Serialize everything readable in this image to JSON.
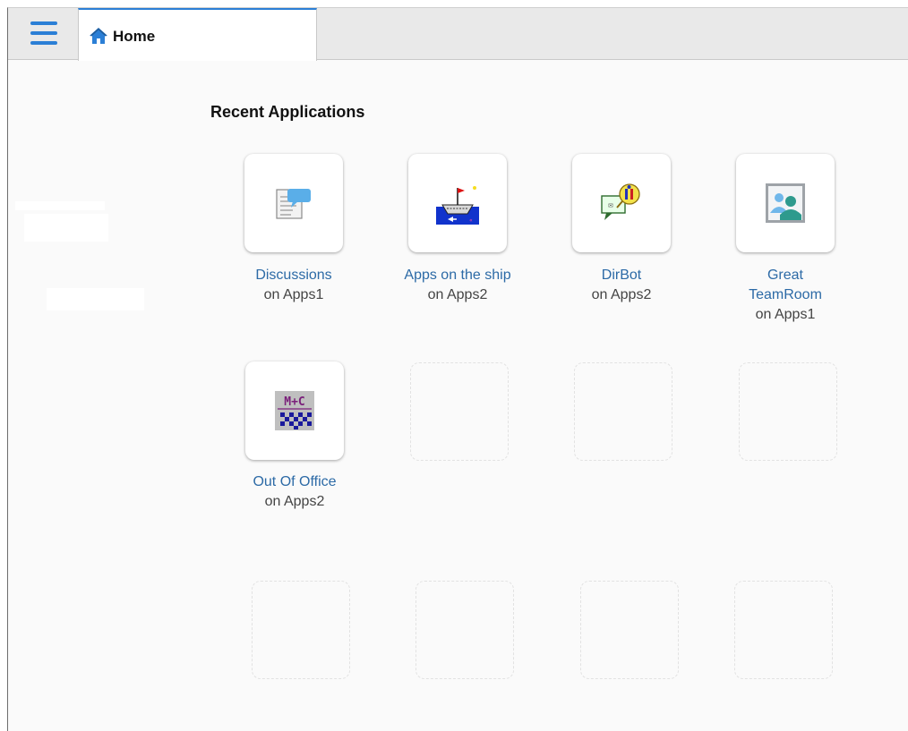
{
  "header": {
    "menu_icon": "hamburger-icon",
    "tab": {
      "label": "Home",
      "icon": "home-icon"
    },
    "accent_color": "#2b7fd6"
  },
  "main": {
    "section_title": "Recent Applications",
    "apps": [
      {
        "name": "Discussions",
        "server": "on Apps1",
        "icon": "discussion-icon"
      },
      {
        "name": "Apps on the ship",
        "server": "on Apps2",
        "icon": "ship-icon"
      },
      {
        "name": "DirBot",
        "server": "on Apps2",
        "icon": "dirbot-icon"
      },
      {
        "name_lines": [
          "Great",
          "TeamRoom"
        ],
        "server": "on Apps1",
        "icon": "teamroom-icon"
      },
      {
        "name": "Out Of Office",
        "server": "on Apps2",
        "icon": "out-of-office-icon",
        "icon_text": "M+C"
      }
    ],
    "link_color": "#2c6aa6"
  }
}
